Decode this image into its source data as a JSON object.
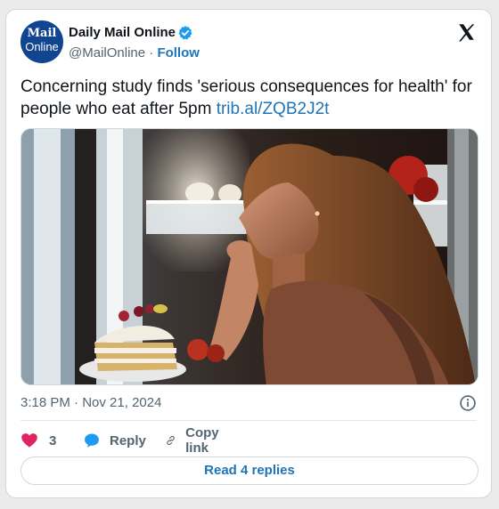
{
  "account": {
    "avatar_line1": "Mail",
    "avatar_line2": "Online",
    "name": "Daily Mail Online",
    "handle": "@MailOnline",
    "separator": "·",
    "follow_label": "Follow"
  },
  "tweet": {
    "text": "Concerning study finds 'serious consequences for health' for people who eat after 5pm",
    "link": "trib.al/ZQB2J2t",
    "time": "3:18 PM",
    "date_separator": "·",
    "date": "Nov 21, 2024"
  },
  "actions": {
    "like_count": "3",
    "reply_label": "Reply",
    "copy_label": "Copy link",
    "read_replies_label": "Read 4 replies"
  },
  "icons": {
    "avatar": "mail-online-logo",
    "verified": "verified-badge-icon",
    "x": "x-logo-icon",
    "info": "info-icon",
    "like": "heart-icon",
    "reply": "speech-bubble-icon",
    "copy": "link-icon"
  },
  "colors": {
    "accent": "#1d74b8",
    "heart": "#e0245e",
    "avatar_bg": "#11458f",
    "secondary_text": "#536471",
    "border": "#cfd9de"
  }
}
